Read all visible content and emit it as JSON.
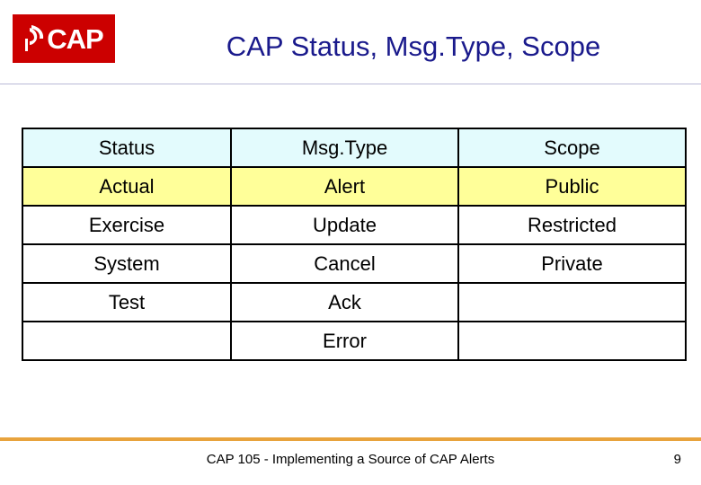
{
  "header": {
    "logo_text": "CAP",
    "logo_icon": "signal-wave-icon",
    "logo_bg": "#cc0000",
    "title": "CAP Status, Msg.Type, Scope",
    "title_color": "#1a1a8c"
  },
  "table": {
    "columns": [
      "Status",
      "Msg.Type",
      "Scope"
    ],
    "header_bg": "#e3fbfd",
    "highlight_row_bg": "#ffff99",
    "rows": [
      [
        "Actual",
        "Alert",
        "Public"
      ],
      [
        "Exercise",
        "Update",
        "Restricted"
      ],
      [
        "System",
        "Cancel",
        "Private"
      ],
      [
        "Test",
        "Ack",
        ""
      ],
      [
        "",
        "Error",
        ""
      ]
    ]
  },
  "footer": {
    "rule_color": "#e8a33d",
    "text": "CAP 105 - Implementing a Source of CAP Alerts",
    "page_number": "9"
  }
}
